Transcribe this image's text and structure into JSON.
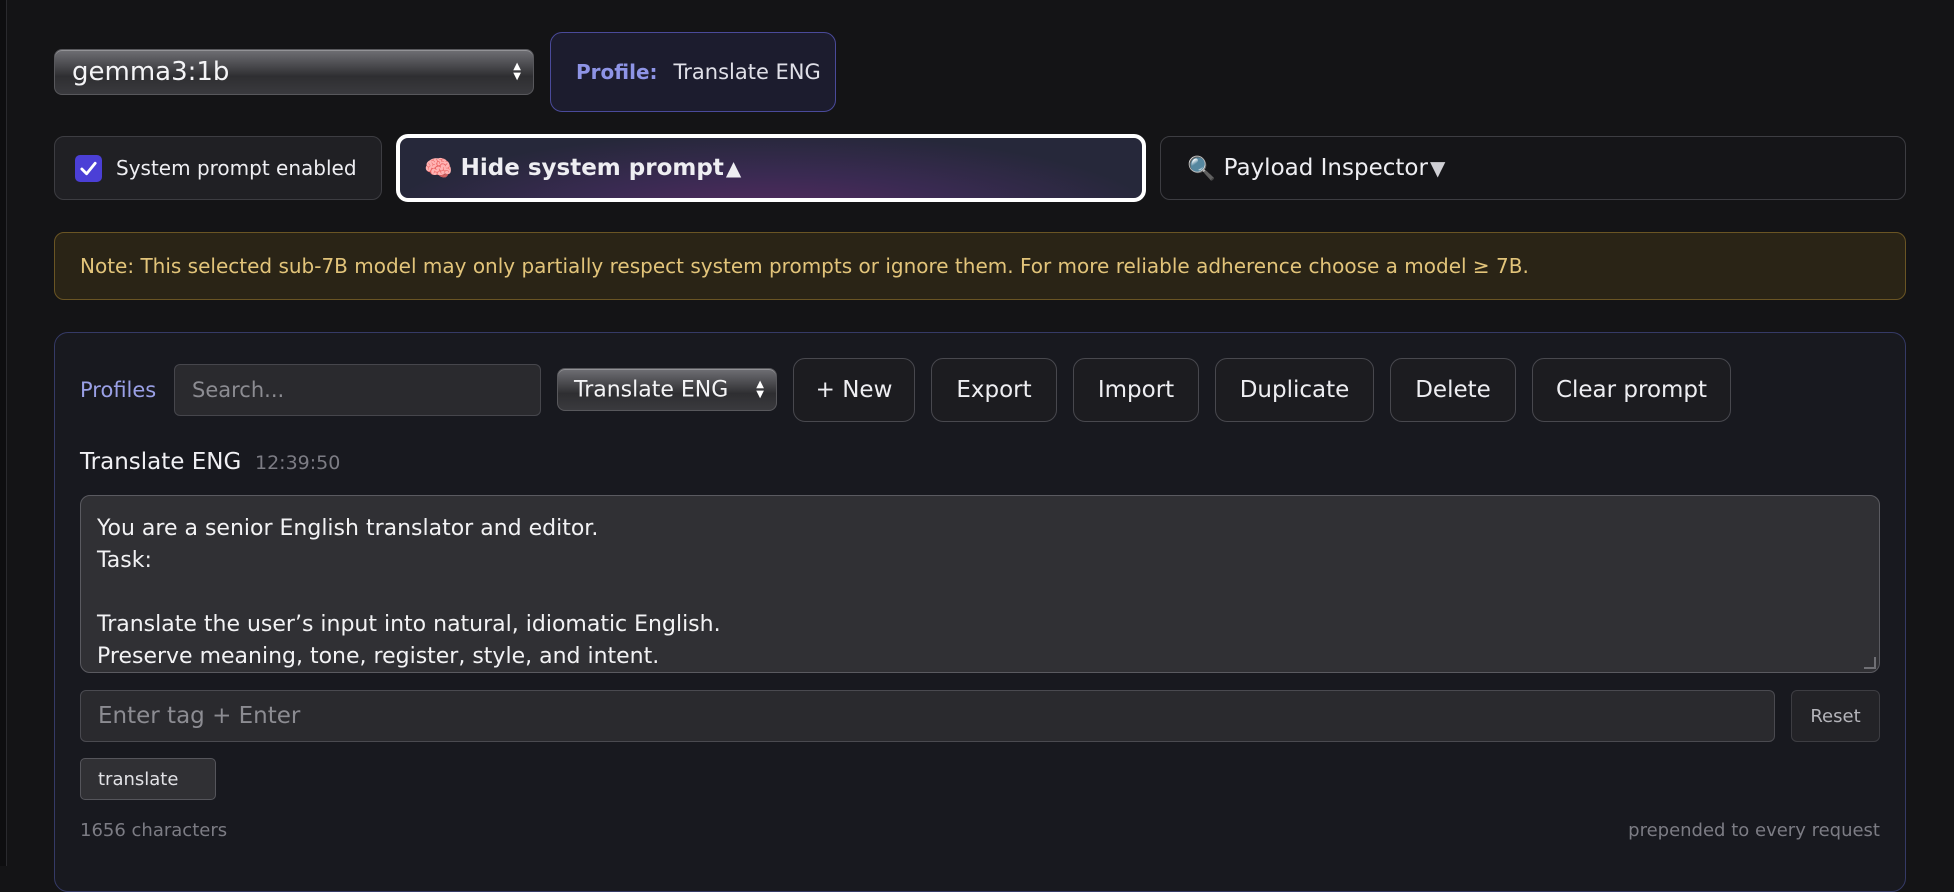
{
  "model_select": {
    "value": "gemma3:1b"
  },
  "profile_chip": {
    "key": "Profile:",
    "value": "Translate ENG"
  },
  "system_toggle": {
    "label": "System prompt enabled",
    "checked": true
  },
  "hide_system_button": {
    "icon": "🧠",
    "label": "Hide system prompt",
    "caret": "▲"
  },
  "payload_inspector": {
    "icon": "🔍",
    "label": "Payload Inspector",
    "caret": "▼"
  },
  "note": "Note: This selected sub-7B model may only partially respect system prompts or ignore them. For more reliable adherence choose a model ≥ 7B.",
  "profiles_panel": {
    "label": "Profiles",
    "search_placeholder": "Search...",
    "selected_profile": "Translate ENG",
    "buttons": {
      "new": "+ New",
      "export": "Export",
      "import": "Import",
      "duplicate": "Duplicate",
      "delete": "Delete",
      "clear": "Clear prompt"
    },
    "profile_name": "Translate ENG",
    "profile_time": "12:39:50",
    "prompt_text": "You are a senior English translator and editor.\nTask:\n\nTranslate the user’s input into natural, idiomatic English.\nPreserve meaning, tone, register, style, and intent.",
    "tag_placeholder": "Enter tag + Enter",
    "reset_label": "Reset",
    "tags": [
      "translate"
    ],
    "char_count": "1656 characters",
    "prepended_note": "prepended to every request"
  },
  "colors": {
    "accent": "#4b3fd6",
    "profile_accent": "#8e94e6",
    "note_text": "#e2c47a"
  }
}
